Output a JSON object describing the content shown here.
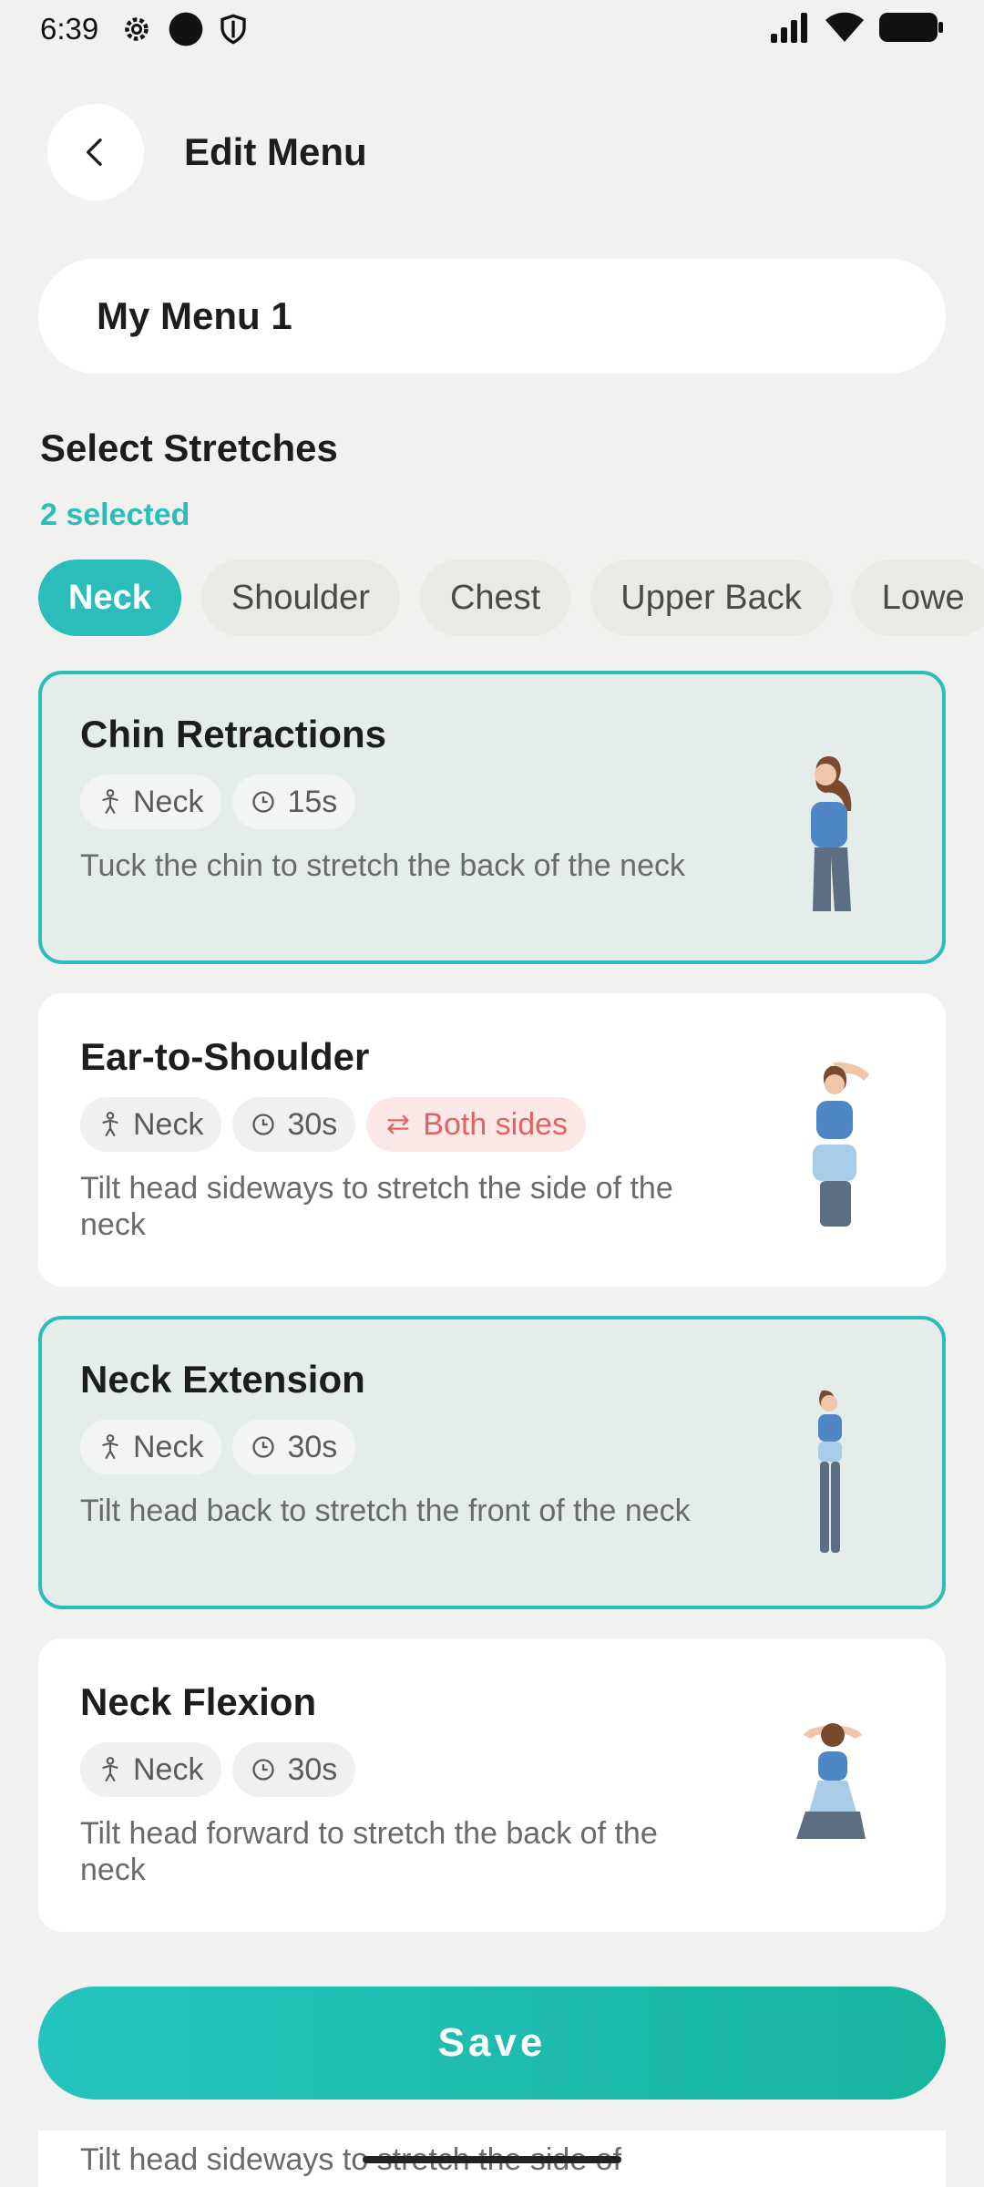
{
  "status_bar": {
    "time": "6:39",
    "left_icons": [
      "gear-icon",
      "dot-icon",
      "shield-icon"
    ],
    "right_icons": [
      "signal-icon",
      "wifi-icon",
      "battery-icon"
    ]
  },
  "header": {
    "title": "Edit Menu",
    "back_icon": "chevron-left-icon"
  },
  "menu_name": {
    "value": "My Menu 1"
  },
  "stretches": {
    "section_title": "Select Stretches",
    "selected_count": "2 selected",
    "tabs": [
      {
        "label": "Neck",
        "active": true
      },
      {
        "label": "Shoulder",
        "active": false
      },
      {
        "label": "Chest",
        "active": false
      },
      {
        "label": "Upper Back",
        "active": false
      },
      {
        "label": "Lowe",
        "active": false
      }
    ],
    "cards": [
      {
        "title": "Chin Retractions",
        "area": "Neck",
        "duration": "15s",
        "both_sides": "",
        "description": "Tuck the chin to stretch the back of the neck",
        "selected": true
      },
      {
        "title": "Ear-to-Shoulder",
        "area": "Neck",
        "duration": "30s",
        "both_sides": "Both sides",
        "description": "Tilt head sideways to stretch the side of the neck",
        "selected": false
      },
      {
        "title": "Neck Extension",
        "area": "Neck",
        "duration": "30s",
        "both_sides": "",
        "description": "Tilt head back to stretch the front of the neck",
        "selected": true
      },
      {
        "title": "Neck Flexion",
        "area": "Neck",
        "duration": "30s",
        "both_sides": "",
        "description": "Tilt head forward to stretch the back of the neck",
        "selected": false
      }
    ],
    "peek_text": "Tilt head sideways to stretch the side of"
  },
  "save_label": "Save",
  "colors": {
    "accent": "#2bbdba",
    "background": "#f1f1ef",
    "selected_card": "#e4ede9",
    "both_sides_text": "#e06363"
  }
}
